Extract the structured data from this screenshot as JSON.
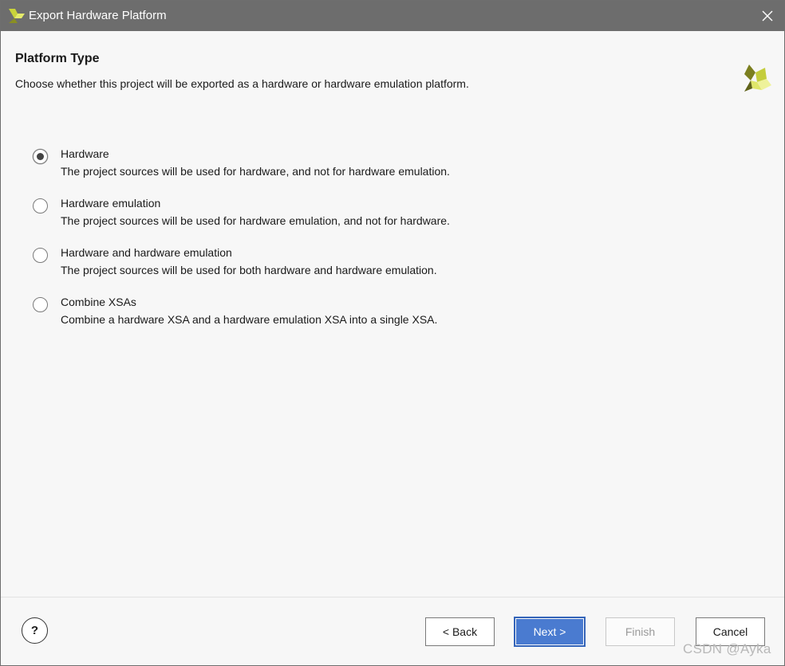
{
  "window": {
    "title": "Export Hardware Platform",
    "close_label": "✕"
  },
  "header": {
    "title": "Platform Type",
    "description": "Choose whether this project will be exported as a hardware or hardware emulation platform."
  },
  "options": [
    {
      "label": "Hardware",
      "description": "The project sources will be used for hardware, and not for hardware emulation.",
      "selected": true
    },
    {
      "label": "Hardware emulation",
      "description": "The project sources will be used for hardware emulation, and not for hardware.",
      "selected": false
    },
    {
      "label": "Hardware and hardware emulation",
      "description": "The project sources will be used for both hardware and hardware emulation.",
      "selected": false
    },
    {
      "label": "Combine XSAs",
      "description": "Combine a hardware XSA and a hardware emulation XSA into a single XSA.",
      "selected": false
    }
  ],
  "footer": {
    "help_label": "?",
    "back_label": "< Back",
    "next_label": "Next >",
    "finish_label": "Finish",
    "cancel_label": "Cancel"
  },
  "watermark": "CSDN @Ayka",
  "colors": {
    "titlebar": "#6d6d6d",
    "primary_button": "#4a7bd0",
    "logo_green": "#b5c334",
    "logo_dark": "#6a6a1a"
  },
  "icons": {
    "app": "xilinx-logo-icon",
    "close": "close-icon",
    "brand": "xilinx-logo-icon",
    "help": "help-icon"
  }
}
